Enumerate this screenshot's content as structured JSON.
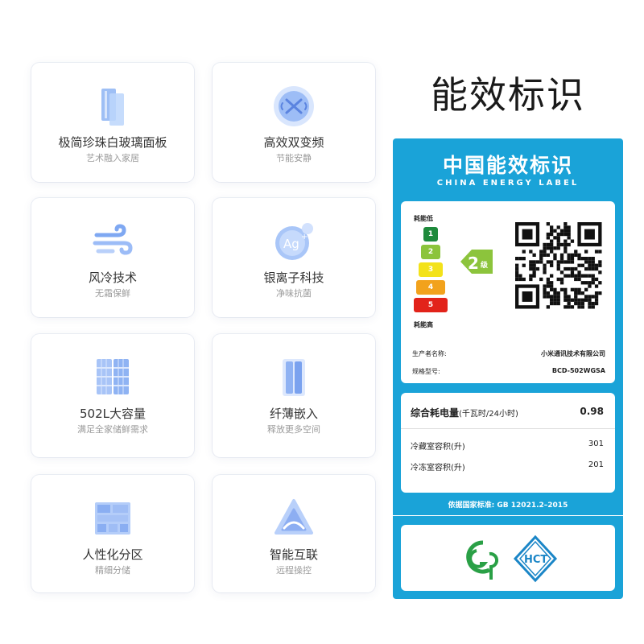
{
  "features": [
    {
      "title": "极简珍珠白玻璃面板",
      "subtitle": "艺术融入家居",
      "icon": "glass-panel-icon"
    },
    {
      "title": "高效双变频",
      "subtitle": "节能安静",
      "icon": "dual-inverter-icon"
    },
    {
      "title": "风冷技术",
      "subtitle": "无霜保鲜",
      "icon": "wind-cooling-icon"
    },
    {
      "title": "银离子科技",
      "subtitle": "净味抗菌",
      "icon": "silver-ion-icon"
    },
    {
      "title": "502L大容量",
      "subtitle": "满足全家储鲜需求",
      "icon": "large-capacity-icon"
    },
    {
      "title": "纤薄嵌入",
      "subtitle": "释放更多空间",
      "icon": "slim-embedded-icon"
    },
    {
      "title": "人性化分区",
      "subtitle": "精细分储",
      "icon": "compartment-icon"
    },
    {
      "title": "智能互联",
      "subtitle": "远程操控",
      "icon": "smart-connect-icon"
    }
  ],
  "heading": "能效标识",
  "energy_label": {
    "title_cn": "中国能效标识",
    "title_en": "CHINA ENERGY LABEL",
    "low_consumption": "耗能低",
    "high_consumption": "耗能高",
    "grades": [
      "1",
      "2",
      "3",
      "4",
      "5"
    ],
    "grade_colors": [
      "#1e8a3c",
      "#8cc43c",
      "#f3e21a",
      "#f2a21c",
      "#e2231a"
    ],
    "current_grade": "2",
    "current_grade_suffix": "级",
    "manufacturer_label": "生产者名称:",
    "manufacturer": "小米通讯技术有限公司",
    "model_label": "规格型号:",
    "model": "BCD-502WGSA",
    "consumption_label": "综合耗电量",
    "consumption_unit": "(千瓦时/24小时)",
    "consumption_value": "0.98",
    "fridge_volume_label": "冷藏室容积(升)",
    "fridge_volume": "301",
    "freezer_volume_label": "冷冻室容积(升)",
    "freezer_volume": "201",
    "standard": "依据国家标准: GB 12021.2–2015",
    "cert_logos": [
      "cqc-logo",
      "hct-logo"
    ],
    "label_color": "#1aa3d8"
  }
}
